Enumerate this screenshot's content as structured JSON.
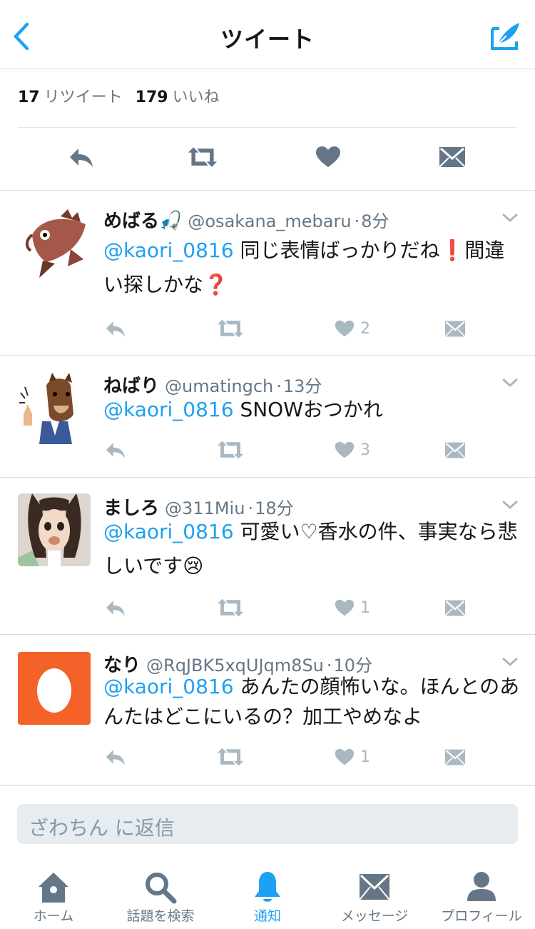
{
  "header": {
    "title": "ツイート"
  },
  "stats": {
    "retweets_count": "17",
    "retweets_label": "リツイート",
    "likes_count": "179",
    "likes_label": "いいね"
  },
  "tweets": [
    {
      "name": "めばる🎣",
      "handle": "@osakana_mebaru",
      "time": "8分",
      "mention": "@kaori_0816",
      "text": " 同じ表情ばっかりだね❗間違い探しかな❓",
      "likes": "2"
    },
    {
      "name": "ねばり",
      "handle": "@umatingch",
      "time": "13分",
      "mention": "@kaori_0816",
      "text": " SNOWおつかれ",
      "likes": "3"
    },
    {
      "name": "ましろ",
      "handle": "@311Miu",
      "time": "18分",
      "mention": "@kaori_0816",
      "text": " 可愛い♡香水の件、事実なら悲しいです😢",
      "likes": "1"
    },
    {
      "name": "なり",
      "handle": "@RqJBK5xqUJqm8Su",
      "time": "10分",
      "mention": "@kaori_0816",
      "text": " あんたの顔怖いな。ほんとのあんたはどこにいるの？加工やめなよ",
      "likes": "1"
    }
  ],
  "reply": {
    "placeholder": "ざわちん に返信"
  },
  "tabs": [
    {
      "label": "ホーム",
      "icon": "home-icon"
    },
    {
      "label": "話題を検索",
      "icon": "search-icon"
    },
    {
      "label": "通知",
      "icon": "bell-icon"
    },
    {
      "label": "メッセージ",
      "icon": "envelope-icon"
    },
    {
      "label": "プロフィール",
      "icon": "person-icon"
    }
  ],
  "colors": {
    "accent": "#1da1f2",
    "muted": "#657786",
    "action": "#aab8c2",
    "egg_bg": "#f4622a"
  }
}
